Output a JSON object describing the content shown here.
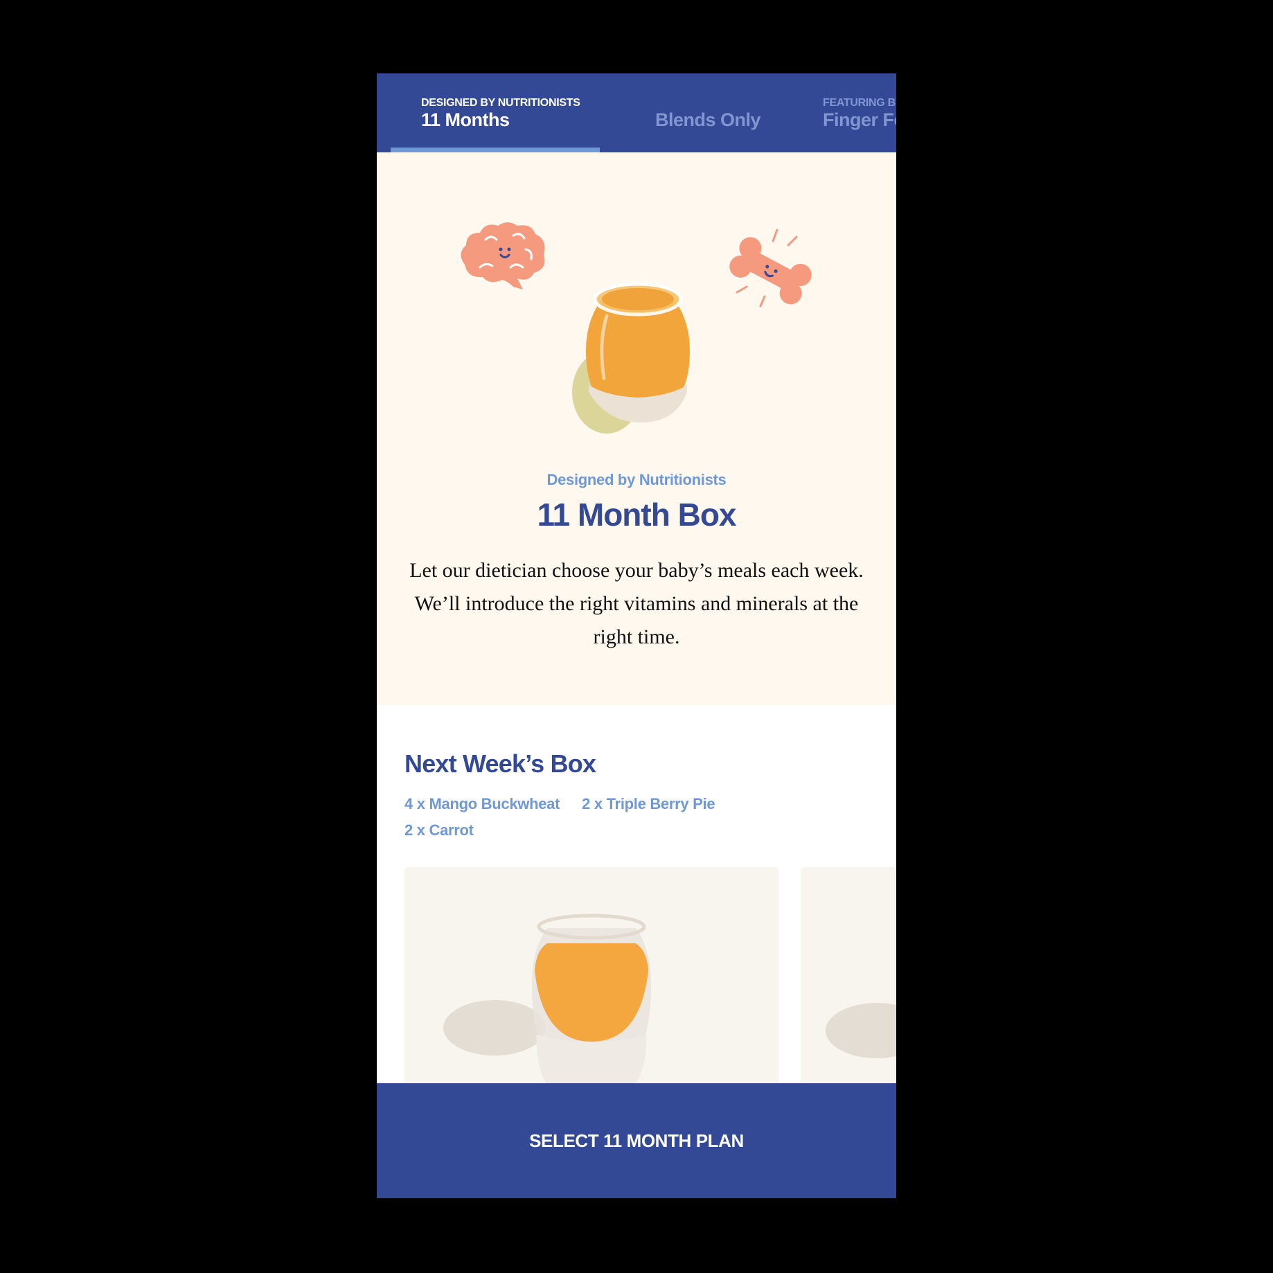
{
  "tabs": [
    {
      "eyebrow": "DESIGNED BY NUTRITIONISTS",
      "label": "11 Months",
      "active": true
    },
    {
      "eyebrow": "",
      "label": "Blends Only",
      "active": false
    },
    {
      "eyebrow": "FEATURING BY",
      "label": "Finger Fo",
      "active": false
    }
  ],
  "hero": {
    "eyebrow": "Designed by Nutritionists",
    "title": "11 Month Box",
    "description": "Let our dietician choose your baby’s meals each week. We’ll introduce the right vitamins and minerals at the right time."
  },
  "next_week": {
    "title": "Next Week’s Box",
    "items": [
      "4 x Mango Buckwheat",
      "2 x Triple Berry Pie",
      "2 x Carrot"
    ]
  },
  "cta": {
    "label": "SELECT 11 MONTH PLAN"
  },
  "colors": {
    "brand_blue": "#344996",
    "accent_blue": "#6f98d6",
    "cream": "#fff8ee",
    "illustration_salmon": "#f59a7e"
  },
  "icons": [
    "brain-illustration-icon",
    "bone-illustration-icon"
  ]
}
